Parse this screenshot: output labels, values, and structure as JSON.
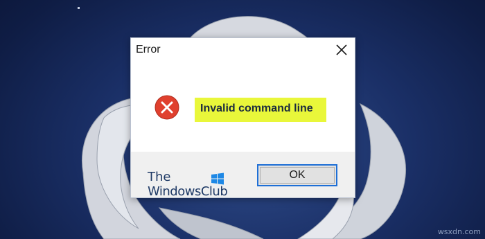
{
  "dialog": {
    "title": "Error",
    "message": "Invalid command line",
    "ok_label": "OK",
    "close_icon": "close-icon",
    "error_icon": "error-icon"
  },
  "watermark": {
    "line1": "The",
    "line2": "WindowsClub"
  },
  "corner_tag": "wsxdn.com",
  "colors": {
    "desktop_background": "#1a2f66",
    "error_red": "#e0402e",
    "highlight_yellow": "#e9f73a",
    "ok_button_border": "#1e6fd6"
  }
}
